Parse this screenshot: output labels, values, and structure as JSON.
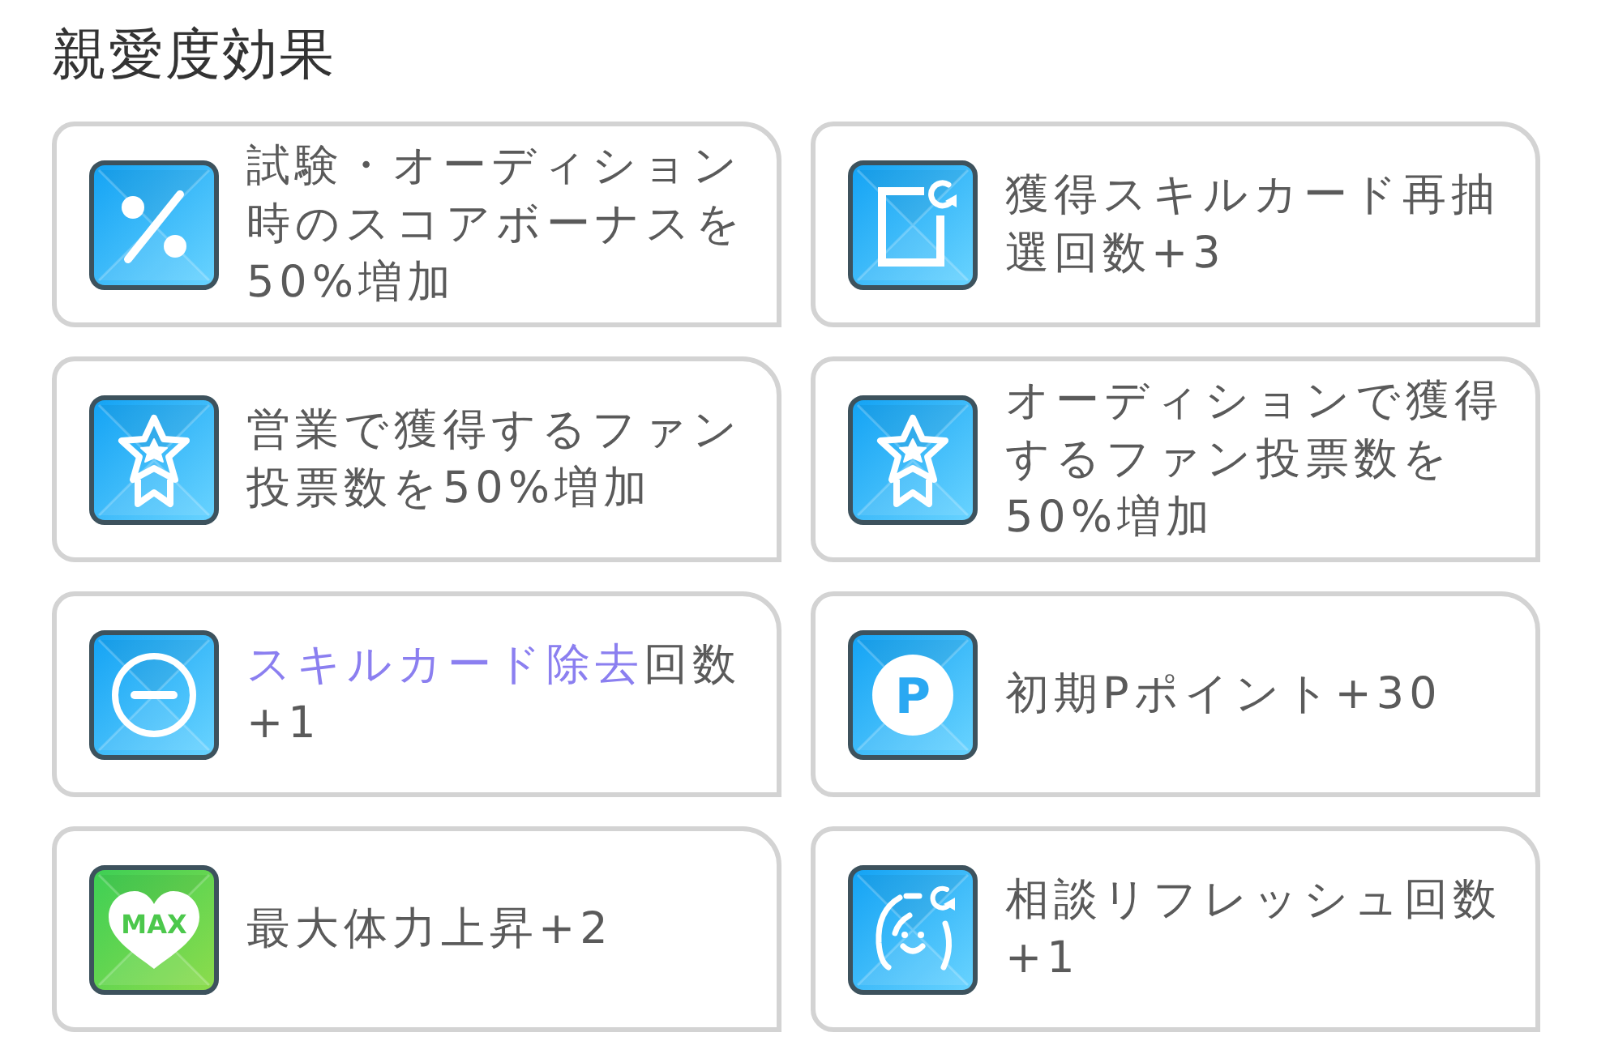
{
  "title": "親愛度効果",
  "effects": [
    {
      "icon": {
        "kind": "percent"
      },
      "description": [
        {
          "kind": "plain",
          "text": "試験・オーディション時のスコアボーナスを50%増加"
        }
      ]
    },
    {
      "icon": {
        "kind": "card-refresh"
      },
      "description": [
        {
          "kind": "plain",
          "text": "獲得スキルカード再抽選回数+3"
        }
      ]
    },
    {
      "icon": {
        "kind": "star-ribbon"
      },
      "description": [
        {
          "kind": "plain",
          "text": "営業で獲得するファン投票数を50%増加"
        }
      ]
    },
    {
      "icon": {
        "kind": "star-ribbon"
      },
      "description": [
        {
          "kind": "plain",
          "text": "オーディションで獲得するファン投票数を50%増加"
        }
      ]
    },
    {
      "icon": {
        "kind": "minus-circle"
      },
      "description": [
        {
          "kind": "keyword",
          "text": "スキルカード除去"
        },
        {
          "kind": "plain",
          "text": "回数+1"
        }
      ]
    },
    {
      "icon": {
        "kind": "coin",
        "label": "P"
      },
      "description": [
        {
          "kind": "plain",
          "text": "初期Pポイント+30"
        }
      ]
    },
    {
      "icon": {
        "kind": "heart",
        "label": "MAX"
      },
      "description": [
        {
          "kind": "plain",
          "text": "最大体力上昇+2"
        }
      ]
    },
    {
      "icon": {
        "kind": "face-refresh"
      },
      "description": [
        {
          "kind": "plain",
          "text": "相談リフレッシュ回数+1"
        }
      ]
    }
  ]
}
